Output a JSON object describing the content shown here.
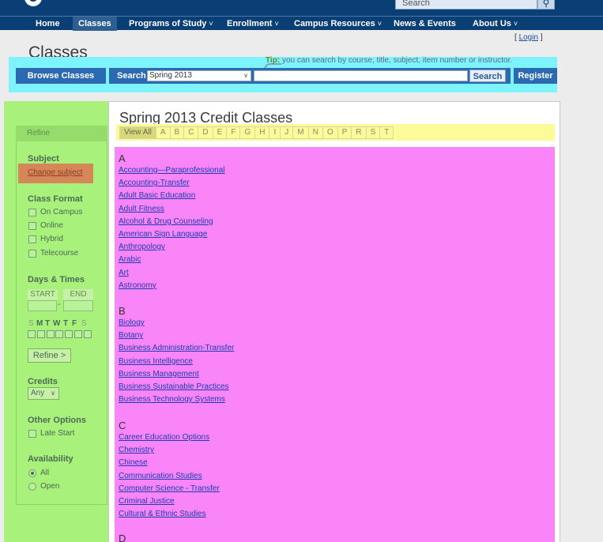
{
  "header": {
    "site_search_placeholder": "Search",
    "site_search_icon": "magnifier-icon",
    "nav": [
      {
        "label": "Home",
        "caret": ""
      },
      {
        "label": "Classes",
        "caret": ""
      },
      {
        "label": "Programs of Study",
        "caret": "˅"
      },
      {
        "label": "Enrollment",
        "caret": "˅"
      },
      {
        "label": "Campus Resources",
        "caret": "˅"
      },
      {
        "label": "News & Events",
        "caret": ""
      },
      {
        "label": "About Us",
        "caret": "˅"
      }
    ]
  },
  "page": {
    "title": "Classes",
    "login_label": "Login",
    "login_open": "[",
    "login_close": "]"
  },
  "search": {
    "tip_label": "Tip:",
    "tip_text": "you can search by course, title, subject, item number or instructor.",
    "browse_label": "Browse Classes",
    "search_label": "Search",
    "term_value": "Spring 2013",
    "search_button": "Search",
    "register_button": "Register"
  },
  "sidebar": {
    "refine_heading": "Refine",
    "subject_heading": "Subject",
    "change_subject": "Change subject",
    "class_format_heading": "Class Format",
    "class_formats": [
      "On Campus",
      "Online",
      "Hybrid",
      "Telecourse"
    ],
    "days_times_heading": "Days & Times",
    "start_label": "START",
    "end_label": "END",
    "time_separator": "-",
    "days": [
      "S",
      "M",
      "T",
      "W",
      "T",
      "F",
      "S"
    ],
    "refine_button": "Refine >",
    "credits_heading": "Credits",
    "credits_value": "Any",
    "other_options_heading": "Other Options",
    "other_options": [
      "Late Start"
    ],
    "availability_heading": "Availability",
    "availability_options": [
      "All",
      "Open"
    ],
    "availability_selected": "All"
  },
  "results": {
    "title": "Spring 2013 Credit Classes",
    "alpha_index": [
      "View All",
      "A",
      "B",
      "C",
      "D",
      "E",
      "F",
      "G",
      "H",
      "I",
      "J",
      "M",
      "N",
      "O",
      "P",
      "R",
      "S",
      "T"
    ],
    "groups": [
      {
        "letter": "A",
        "subjects": [
          "Accounting—Paraprofessional",
          "Accounting-Transfer",
          "Adult Basic Education",
          "Adult Fitness",
          "Alcohol & Drug Counseling",
          "American Sign Language",
          "Anthropology",
          "Arabic",
          "Art",
          "Astronomy"
        ]
      },
      {
        "letter": "B",
        "subjects": [
          "Biology",
          "Botany",
          "Business Administration-Transfer",
          "Business Intelligence",
          "Business Management",
          "Business Sustainable Practices",
          "Business Technology Systems"
        ]
      },
      {
        "letter": "C",
        "subjects": [
          "Career Education Options",
          "Chemistry",
          "Chinese",
          "Communication Studies",
          "Computer Science - Transfer",
          "Criminal Justice",
          "Cultural & Ethnic Studies"
        ]
      },
      {
        "letter": "D",
        "subjects": []
      }
    ]
  }
}
